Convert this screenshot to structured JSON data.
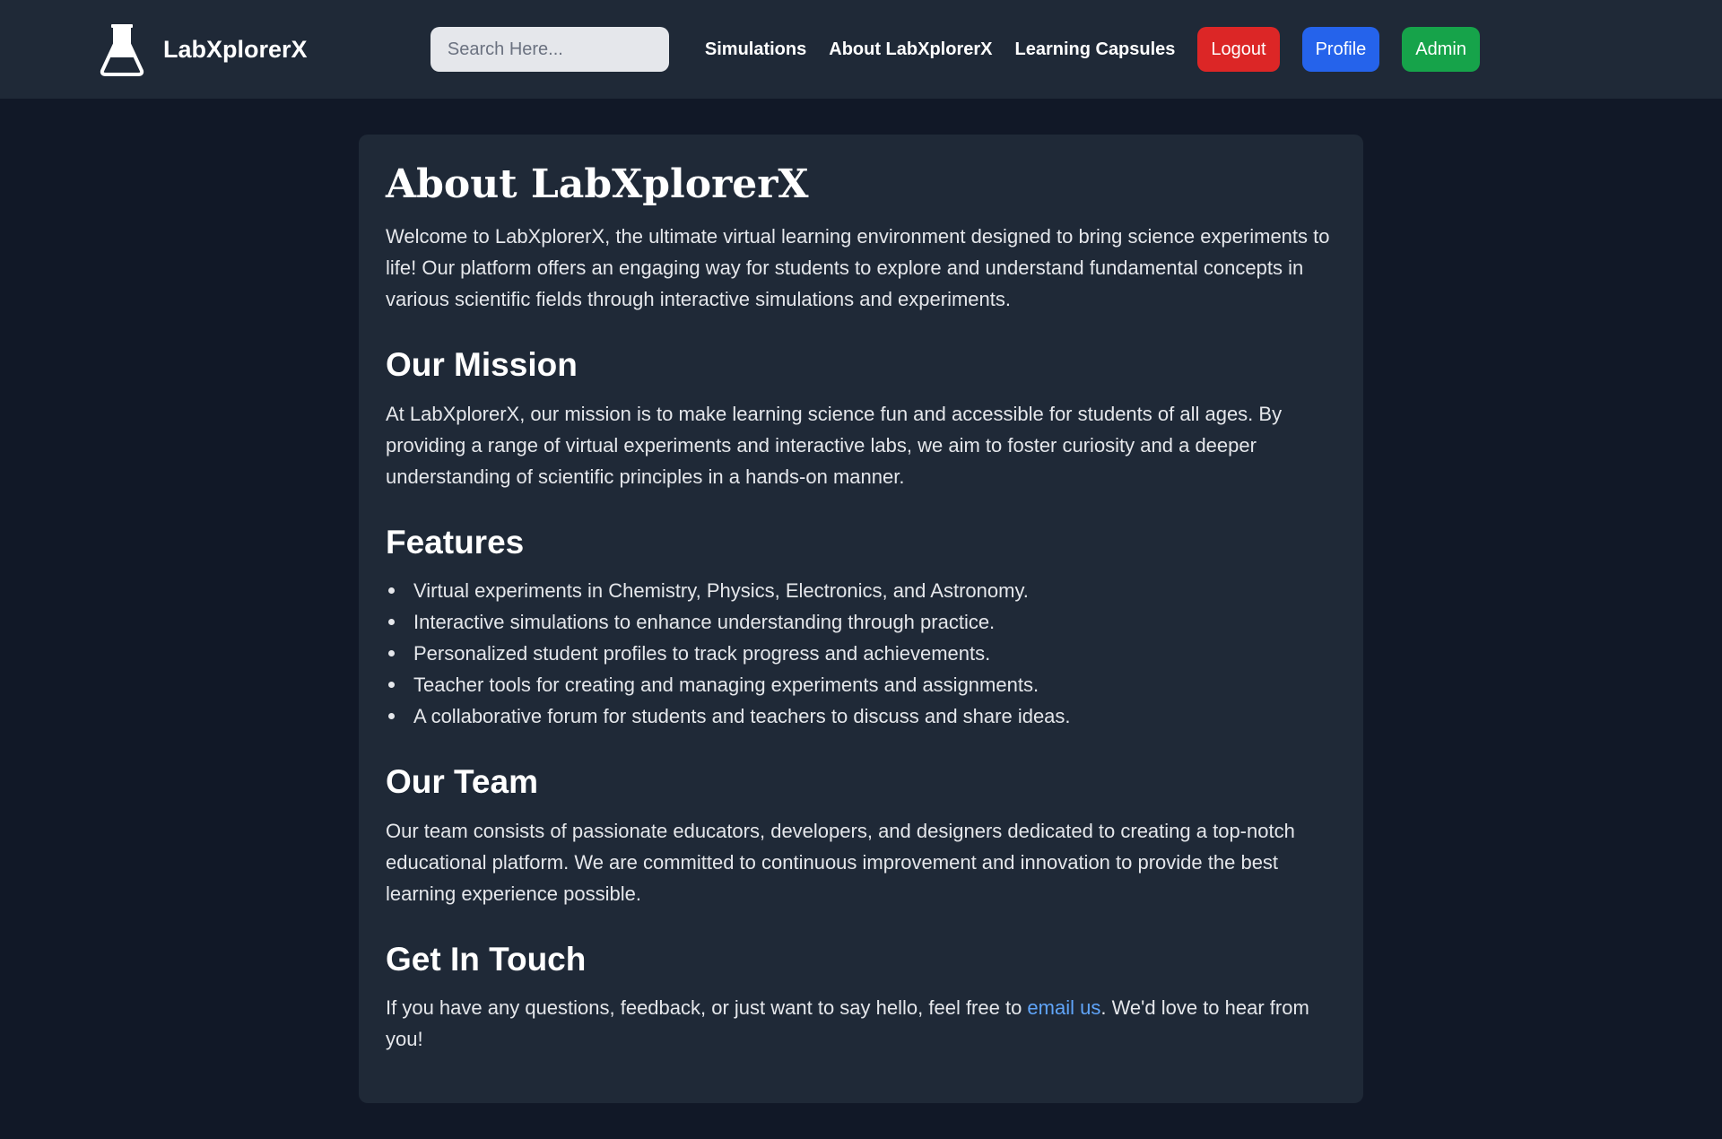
{
  "nav": {
    "brand": "LabXplorerX",
    "logo_icon": "flask-icon",
    "search_placeholder": "Search Here...",
    "search_icon": "search-icon",
    "links": [
      "Simulations",
      "About LabXplorerX",
      "Learning Capsules"
    ],
    "buttons": {
      "logout": "Logout",
      "profile": "Profile",
      "admin": "Admin"
    }
  },
  "colors": {
    "page_background": "#111827",
    "panel_background": "#1f2937",
    "logout": "#dc2626",
    "profile": "#2563eb",
    "admin": "#16a34a",
    "link": "#60a5fa"
  },
  "content": {
    "title": "About LabXplorerX",
    "intro": "Welcome to LabXplorerX, the ultimate virtual learning environment designed to bring science experiments to life! Our platform offers an engaging way for students to explore and understand fundamental concepts in various scientific fields through interactive simulations and experiments.",
    "mission": {
      "heading": "Our Mission",
      "text": "At LabXplorerX, our mission is to make learning science fun and accessible for students of all ages. By providing a range of virtual experiments and interactive labs, we aim to foster curiosity and a deeper understanding of scientific principles in a hands-on manner."
    },
    "features": {
      "heading": "Features",
      "items": [
        "Virtual experiments in Chemistry, Physics, Electronics, and Astronomy.",
        "Interactive simulations to enhance understanding through practice.",
        "Personalized student profiles to track progress and achievements.",
        "Teacher tools for creating and managing experiments and assignments.",
        "A collaborative forum for students and teachers to discuss and share ideas."
      ]
    },
    "team": {
      "heading": "Our Team",
      "text": "Our team consists of passionate educators, developers, and designers dedicated to creating a top-notch educational platform. We are committed to continuous improvement and innovation to provide the best learning experience possible."
    },
    "contact": {
      "heading": "Get In Touch",
      "text_before": "If you have any questions, feedback, or just want to say hello, feel free to ",
      "link_text": "email us",
      "text_after": ". We'd love to hear from you!"
    }
  }
}
